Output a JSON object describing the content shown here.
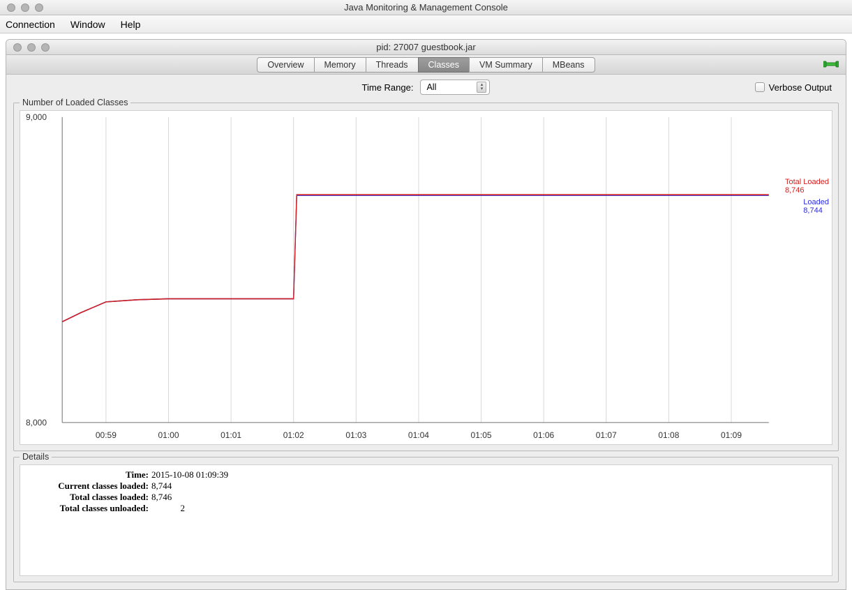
{
  "app": {
    "title": "Java Monitoring & Management Console"
  },
  "menu": {
    "connection": "Connection",
    "window": "Window",
    "help": "Help"
  },
  "window": {
    "title": "pid: 27007 guestbook.jar"
  },
  "tabs": {
    "overview": "Overview",
    "memory": "Memory",
    "threads": "Threads",
    "classes": "Classes",
    "vm_summary": "VM Summary",
    "mbeans": "MBeans",
    "active": "classes"
  },
  "options": {
    "time_range_label": "Time Range:",
    "time_range_value": "All",
    "verbose_label": "Verbose Output"
  },
  "chart_panel_title": "Number of Loaded Classes",
  "details_panel_title": "Details",
  "details": {
    "time_label": "Time:",
    "time_value": "2015-10-08 01:09:39",
    "current_loaded_label": "Current classes loaded:",
    "current_loaded_value": "8,744",
    "total_loaded_label": "Total classes loaded:",
    "total_loaded_value": "8,746",
    "total_unloaded_label": "Total classes unloaded:",
    "total_unloaded_value": "2"
  },
  "chart_legend": {
    "total_loaded_name": "Total Loaded",
    "total_loaded_value": "8,746",
    "loaded_name": "Loaded",
    "loaded_value": "8,744"
  },
  "chart_data": {
    "type": "line",
    "title": "Number of Loaded Classes",
    "xlabel": "",
    "ylabel": "",
    "x_ticks": [
      "00:59",
      "01:00",
      "01:01",
      "01:02",
      "01:03",
      "01:04",
      "01:05",
      "01:06",
      "01:07",
      "01:08",
      "01:09"
    ],
    "y_ticks": [
      8000,
      9000
    ],
    "ylim": [
      8000,
      9000
    ],
    "series": [
      {
        "name": "Loaded",
        "color": "#2a2ae0",
        "x": [
          "00:58.3",
          "00:58.6",
          "00:59.0",
          "00:59.5",
          "01:00",
          "01:01",
          "01:02",
          "01:02.05",
          "01:03",
          "01:04",
          "01:05",
          "01:06",
          "01:07",
          "01:08",
          "01:09",
          "01:09.6"
        ],
        "values": [
          8330,
          8360,
          8395,
          8402,
          8405,
          8405,
          8405,
          8744,
          8744,
          8744,
          8744,
          8744,
          8744,
          8744,
          8744,
          8744
        ]
      },
      {
        "name": "Total Loaded",
        "color": "#d02020",
        "x": [
          "00:58.3",
          "00:58.6",
          "00:59.0",
          "00:59.5",
          "01:00",
          "01:01",
          "01:02",
          "01:02.05",
          "01:03",
          "01:04",
          "01:05",
          "01:06",
          "01:07",
          "01:08",
          "01:09",
          "01:09.6"
        ],
        "values": [
          8330,
          8360,
          8395,
          8402,
          8405,
          8405,
          8405,
          8746,
          8746,
          8746,
          8746,
          8746,
          8746,
          8746,
          8746,
          8746
        ]
      }
    ]
  }
}
